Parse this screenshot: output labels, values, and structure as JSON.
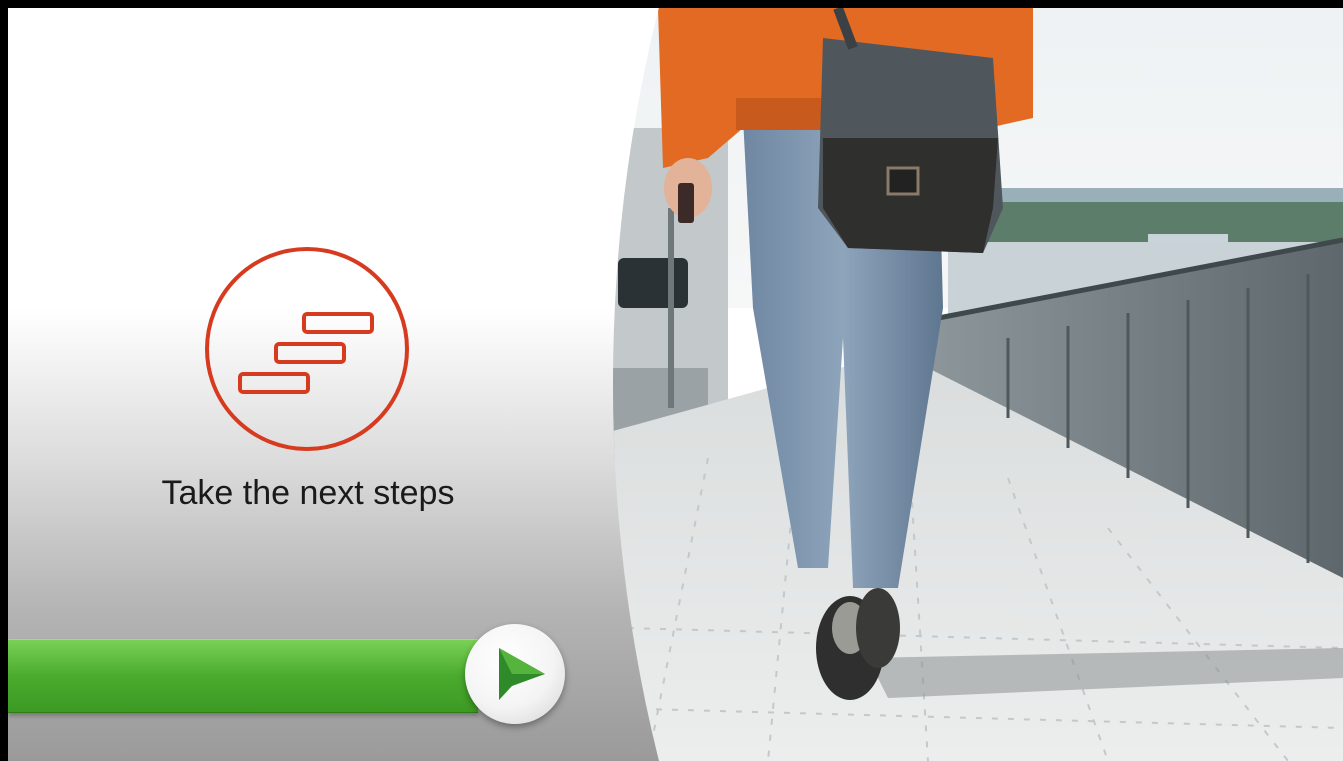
{
  "slide": {
    "title": "Take the next steps",
    "emblem_icon": "steps-icon",
    "next_icon": "play-arrow-icon",
    "photo": "person-walking-on-bridge-image"
  },
  "colors": {
    "accent_red": "#d63b1f",
    "progress_green": "#4aab2e",
    "arrow_green": "#2f8a2a"
  }
}
